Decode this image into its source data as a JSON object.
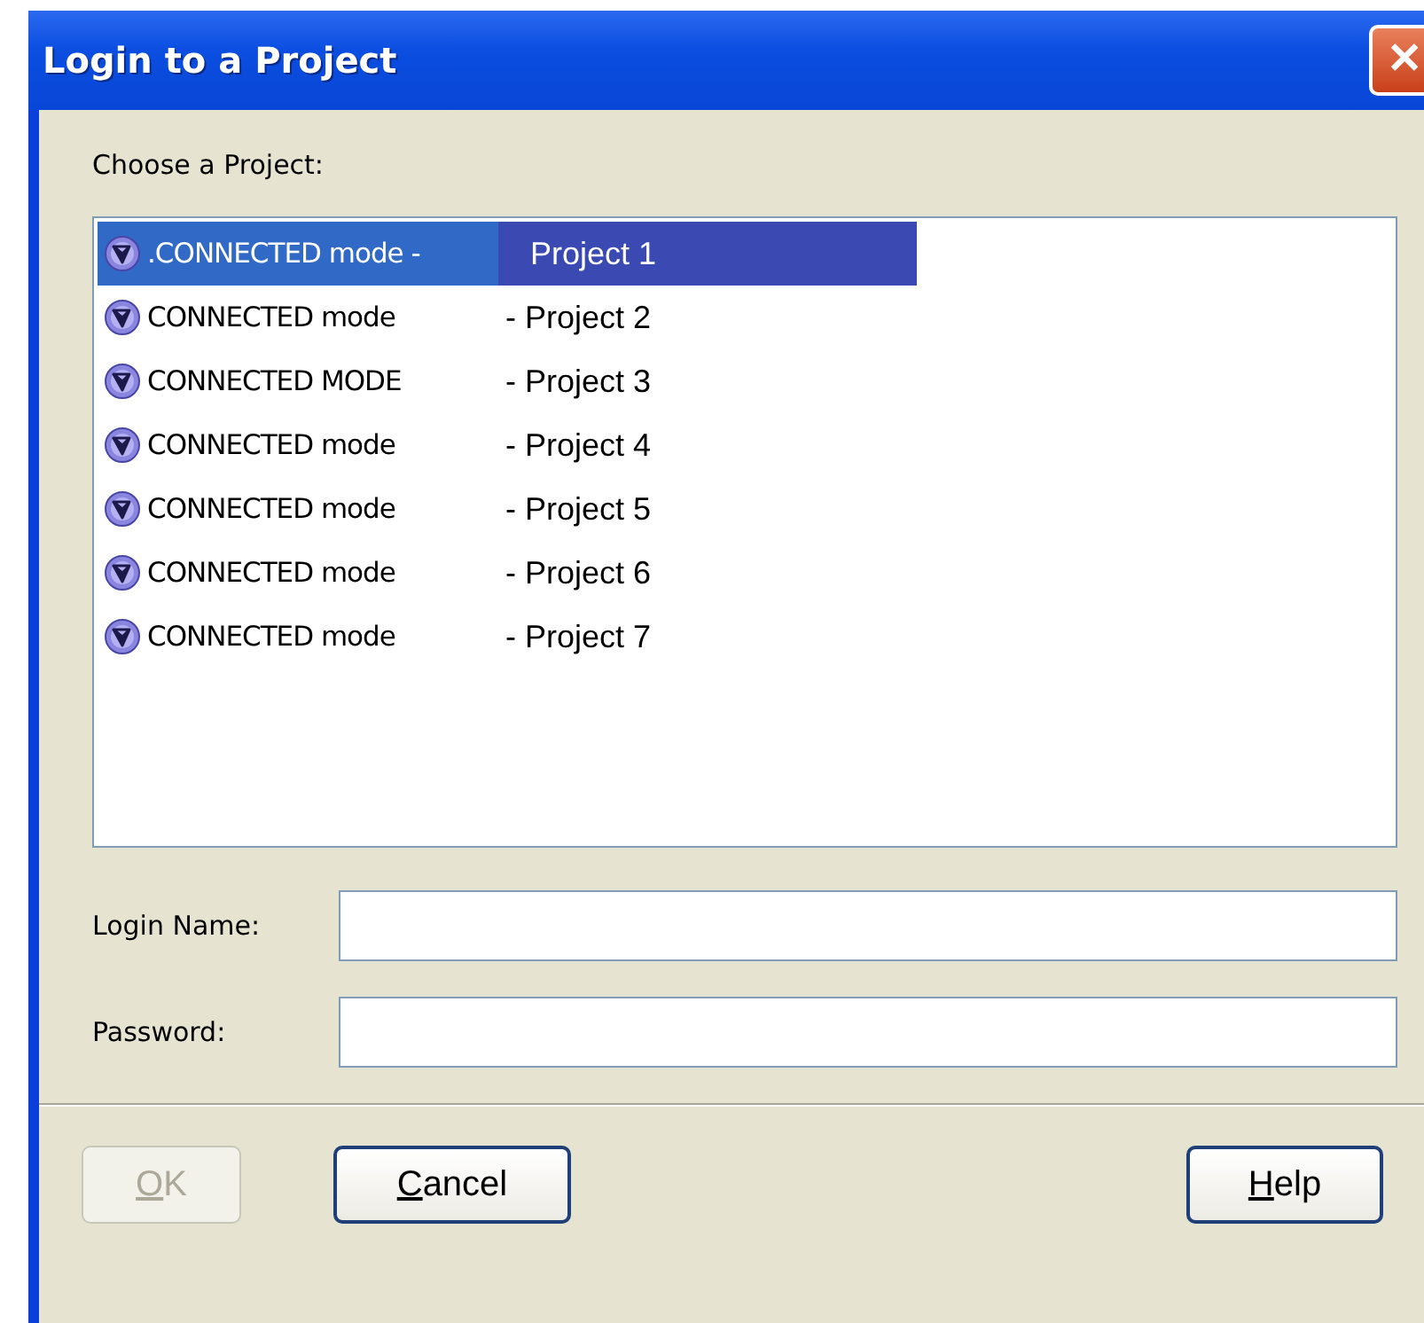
{
  "window": {
    "title": "Login to a Project",
    "close": "✕"
  },
  "list_label": "Choose a Project:",
  "projects": [
    {
      "mode": ".CONNECTED mode -",
      "name": "Project 1",
      "selected": true
    },
    {
      "mode": "CONNECTED mode",
      "name": "- Project 2",
      "selected": false
    },
    {
      "mode": "CONNECTED MODE",
      "name": "- Project 3",
      "selected": false
    },
    {
      "mode": "CONNECTED mode",
      "name": "- Project 4",
      "selected": false
    },
    {
      "mode": "CONNECTED mode",
      "name": "- Project 5",
      "selected": false
    },
    {
      "mode": "CONNECTED mode",
      "name": "- Project 6",
      "selected": false
    },
    {
      "mode": "CONNECTED mode",
      "name": "- Project 7",
      "selected": false
    }
  ],
  "fields": [
    {
      "label": "Login Name:"
    },
    {
      "label": "Password:"
    }
  ],
  "buttons": [
    {
      "key": "O",
      "rest": "K",
      "disabled": true
    },
    {
      "key": "C",
      "rest": "ancel",
      "disabled": false
    },
    {
      "key": "H",
      "rest": "elp",
      "disabled": false
    }
  ]
}
